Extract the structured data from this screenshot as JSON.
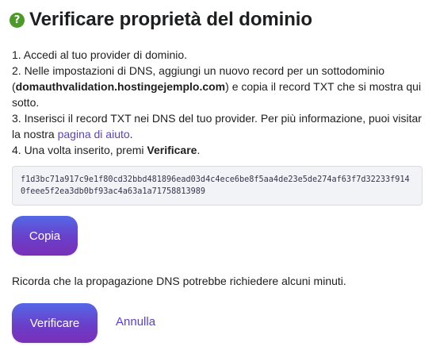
{
  "header": {
    "help_icon_glyph": "?",
    "title": "Verificare proprietà del dominio"
  },
  "instructions": {
    "step1": "1. Accedi al tuo provider di dominio.",
    "step2_pre": "2. Nelle impostazioni di DNS, aggiungi un nuovo record per un sottodominio (",
    "step2_domain": "domauthvalidation.hostingejemplo.com",
    "step2_post": ") e copia il record TXT che si mostra qui sotto.",
    "step3_pre": "3. Inserisci il record TXT nei DNS del tuo provider. Per più informazione, puoi visitar la nostra ",
    "step3_link": "pagina di aiuto",
    "step3_post": ".",
    "step4_pre": "4. Una volta inserito, premi ",
    "step4_bold": "Verificare",
    "step4_post": "."
  },
  "txt_record": "f1d3bc71a917c9e1f80cd32bbd481896ead03d4c4ece6be8f5aa4de23e5de274af63f7d32233f9140feee5f2ea3db0bf93ac4a63a1a71758813989",
  "buttons": {
    "copy_label": "Copia",
    "verify_label": "Verificare",
    "cancel_label": "Annulla"
  },
  "reminder": "Ricorda che la propagazione DNS potrebbe richiedere alcuni minuti.",
  "colors": {
    "help_icon": "#4c9a2a",
    "link": "#5a3ed6",
    "button_gradient_top": "#5468e7",
    "button_gradient_bottom": "#7a2fb8",
    "code_background": "#f2f3f6"
  }
}
